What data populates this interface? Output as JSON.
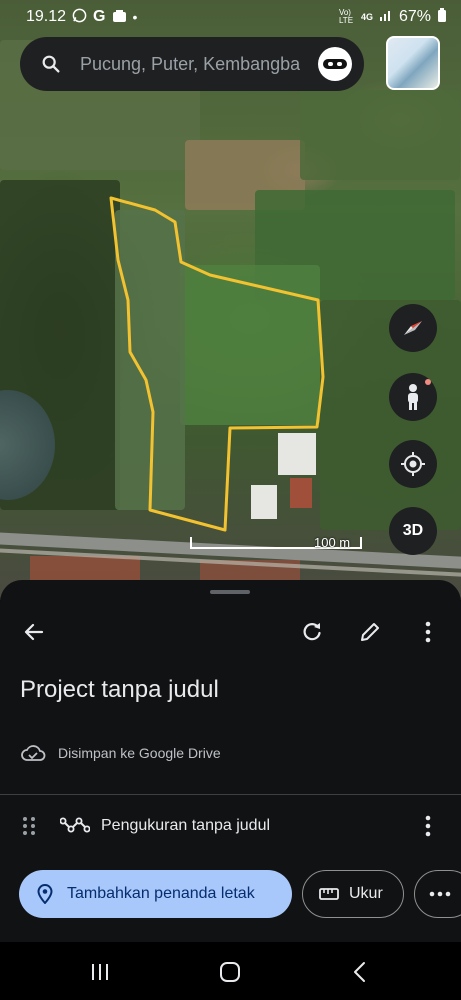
{
  "status_bar": {
    "time": "19.12",
    "battery": "67%",
    "network": "4G",
    "volte": "Vo) LTE"
  },
  "search": {
    "placeholder": "Pucung, Puter, Kembangbahu"
  },
  "map": {
    "scale_label": "100 m",
    "polygon_color": "#f2c230"
  },
  "controls": {
    "threed_label": "3D"
  },
  "sheet": {
    "title": "Project tanpa judul",
    "saved_text": "Disimpan ke Google Drive",
    "measurement_label": "Pengukuran tanpa judul",
    "add_placemark_label": "Tambahkan penanda letak",
    "measure_label": "Ukur"
  },
  "colors": {
    "accent_chip": "#a8c7fa",
    "sheet_bg": "#111213"
  }
}
